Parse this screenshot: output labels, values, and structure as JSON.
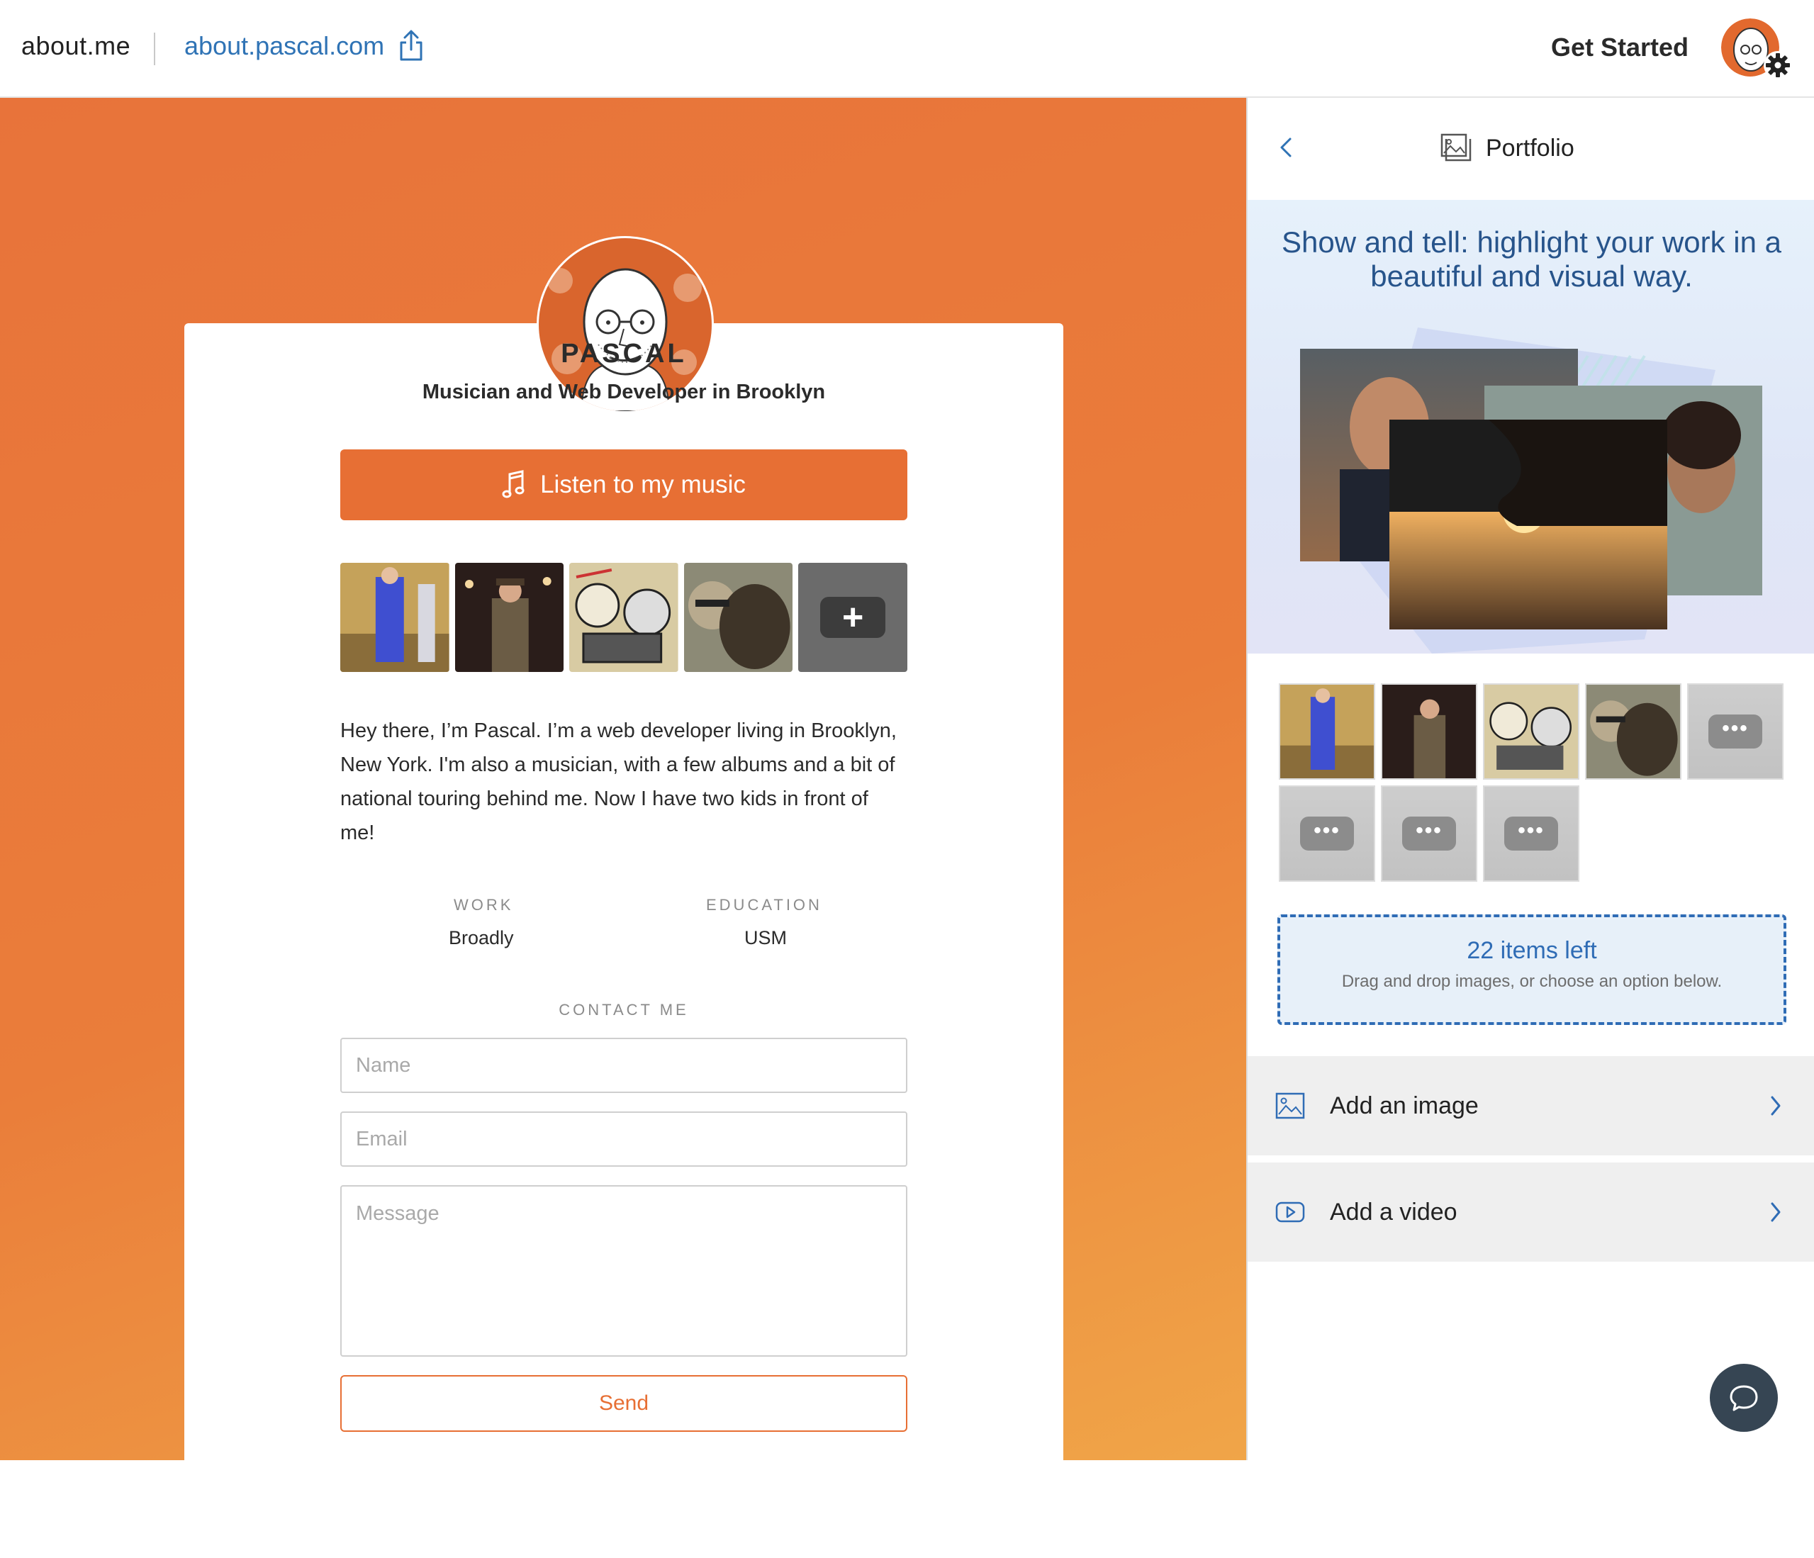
{
  "topbar": {
    "brand": "about.me",
    "site_url": "about.pascal.com",
    "get_started": "Get Started"
  },
  "profile": {
    "name": "PASCAL",
    "tagline": "Musician and Web Developer in Brooklyn",
    "music_button": "Listen to my music",
    "bio": "Hey there, I’m Pascal. I’m a web developer living in Brooklyn, New York. I'm also a musician, with a few albums and a bit of national touring behind me. Now I have two kids in front of me!",
    "work": {
      "label": "WORK",
      "value": "Broadly"
    },
    "education": {
      "label": "EDUCATION",
      "value": "USM"
    },
    "contact": {
      "label": "CONTACT ME",
      "name_placeholder": "Name",
      "email_placeholder": "Email",
      "message_placeholder": "Message",
      "send_label": "Send"
    }
  },
  "panel": {
    "title": "Portfolio",
    "hero_text": "Show and tell: highlight your work in a beautiful and visual way.",
    "items_left": "22 items left",
    "drop_hint": "Drag and drop images, or choose an option below.",
    "options": [
      {
        "label": "Add an image",
        "icon": "image-icon"
      },
      {
        "label": "Add a video",
        "icon": "video-icon"
      }
    ]
  },
  "colors": {
    "accent": "#e76f34",
    "link": "#2f73b5",
    "panel_accent": "#2f6cb5"
  }
}
